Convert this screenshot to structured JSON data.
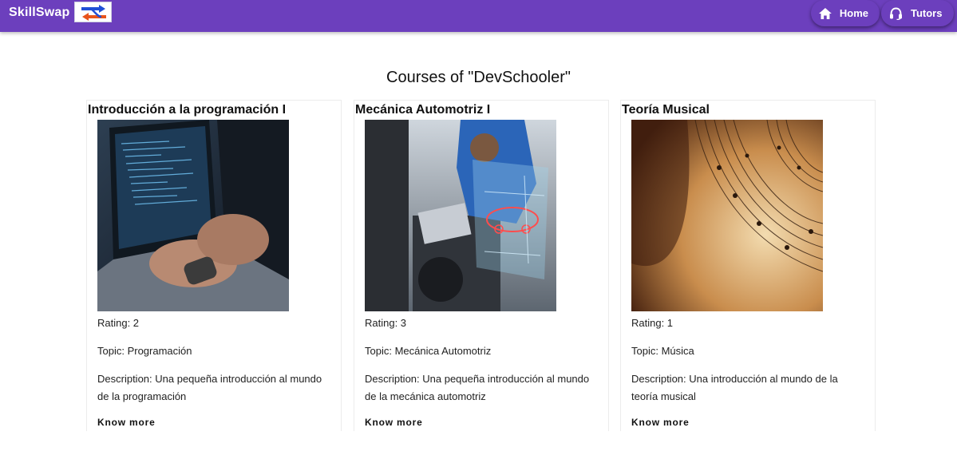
{
  "header": {
    "brand": "SkillSwap",
    "logo_icon": "skillswap-logo",
    "nav": [
      {
        "label": "Home",
        "icon": "home-icon"
      },
      {
        "label": "Tutors",
        "icon": "headset-icon"
      }
    ],
    "colors": {
      "bar": "#6c3fbd",
      "text": "#ffffff"
    }
  },
  "main": {
    "title": "Courses of \"DevSchooler\"",
    "courses": [
      {
        "title": "Introducción a la programación I",
        "image": "laptop-code-photo",
        "rating_text": "Rating: 2",
        "topic_text": "Topic: Programación",
        "description_text": "Description: Una pequeña introducción al mundo de la programación",
        "link_label": "Know more"
      },
      {
        "title": "Mecánica Automotriz I",
        "image": "car-mechanic-photo",
        "rating_text": "Rating: 3",
        "topic_text": "Topic: Mecánica Automotriz",
        "description_text": "Description: Una pequeña introducción al mundo de la mecánica automotriz",
        "link_label": "Know more"
      },
      {
        "title": "Teoría Musical",
        "image": "sheet-music-photo",
        "rating_text": "Rating: 1",
        "topic_text": "Topic: Música",
        "description_text": "Description: Una introducción al mundo de la teoría musical",
        "link_label": "Know more"
      }
    ]
  }
}
